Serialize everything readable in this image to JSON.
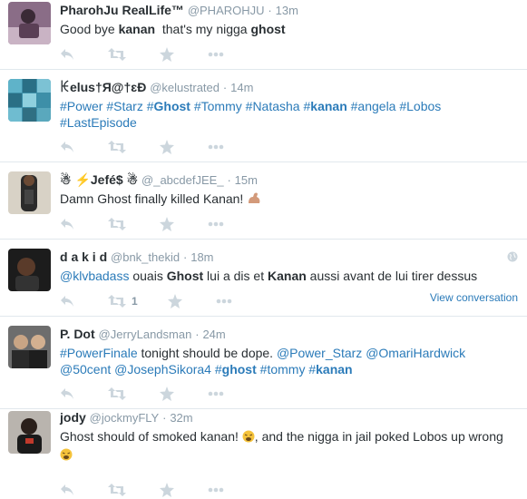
{
  "tweets": [
    {
      "fullname": "PharohJu RealLife™",
      "handle": "@PHAROHJU",
      "time": "13m",
      "text_parts": [
        "Good bye ",
        "kanan",
        "  that's my nigga ",
        "ghost"
      ],
      "avatar_icon": "user-avatar-photo"
    },
    {
      "fullname": "ꀘelus†Я@†ɛÐ",
      "handle": "@kelustrated",
      "time": "14m",
      "hashtags": [
        "#Power",
        "#Starz",
        "#",
        "Ghost",
        "#Tommy",
        "#Natasha",
        "#",
        "kanan",
        "#angela",
        "#Lobos",
        "#LastEpisode"
      ],
      "avatar_icon": "collage-avatar"
    },
    {
      "fullname": "☃ ⚡Jefé$ ☃",
      "handle": "@_abcdefJEE_",
      "time": "15m",
      "text": "Damn Ghost finally killed Kanan!",
      "emoji": "flexed-biceps-icon",
      "avatar_icon": "user-avatar-photo"
    },
    {
      "fullname": "d a k i d",
      "handle": "@bnk_thekid",
      "time": "18m",
      "mention": "@klvbadass",
      "text_parts": [
        " ouais ",
        "Ghost",
        " lui a dis et ",
        "Kanan",
        " aussi avant de lui tirer dessus"
      ],
      "retweet_count": "1",
      "view_conversation": "View conversation",
      "avatar_icon": "user-avatar-photo"
    },
    {
      "fullname": "P. Dot",
      "handle": "@JerryLandsman",
      "time": "24m",
      "line1_hashtag": "#PowerFinale",
      "line1_text": " tonight should be dope. ",
      "line1_mentions": [
        "@Power_Starz",
        "@OmariHardwick"
      ],
      "line2_mentions": [
        "@50cent",
        "@JosephSikora4"
      ],
      "line2_hashtags": [
        "#",
        "ghost",
        "#tommy",
        "#",
        "kanan"
      ],
      "avatar_icon": "user-avatar-photo"
    },
    {
      "fullname": "jody",
      "handle": "@jockmyFLY",
      "time": "32m",
      "text_a": "Ghost should of smoked kanan! ",
      "text_b": ", and the nigga in jail poked Lobos up wrong",
      "emoji": "weary-face-icon",
      "avatar_icon": "user-avatar-photo"
    }
  ],
  "colors": {
    "link": "#2b7bb9",
    "muted": "#8899a6",
    "action": "#ccd6dd",
    "divider": "#e1e8ed"
  },
  "separator": "·"
}
